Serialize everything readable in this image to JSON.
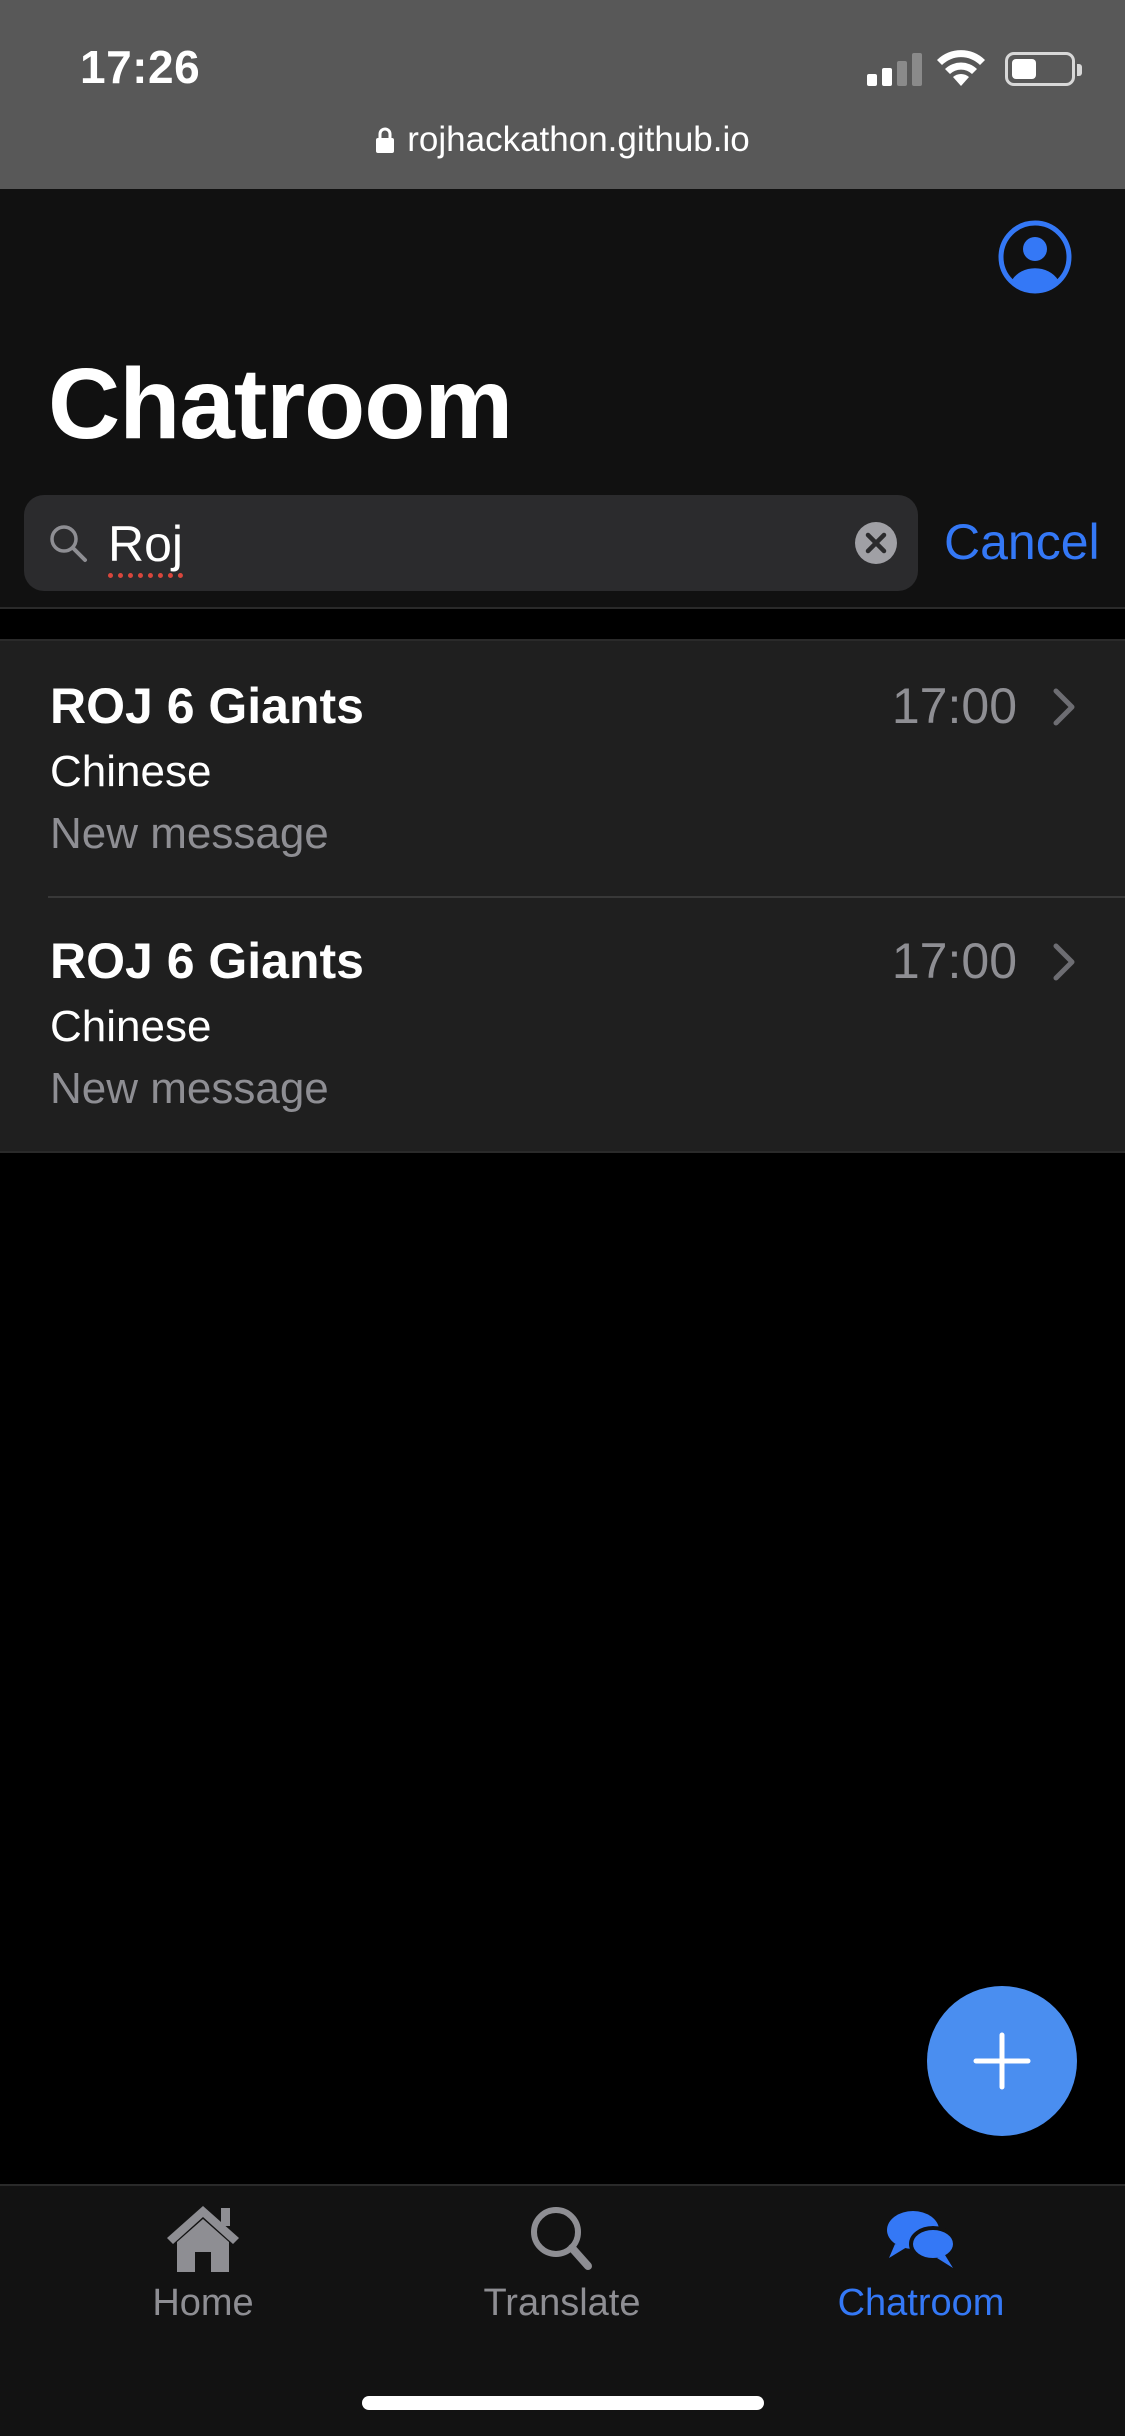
{
  "status_bar": {
    "time": "17:26",
    "url": "rojhackathon.github.io"
  },
  "header": {
    "title": "Chatroom",
    "profile_icon": "user-circle-icon"
  },
  "search": {
    "value": "Roj",
    "cancel_label": "Cancel"
  },
  "chats": [
    {
      "name": "ROJ 6 Giants",
      "language": "Chinese",
      "last_message": "New message",
      "time": "17:00"
    },
    {
      "name": "ROJ 6 Giants",
      "language": "Chinese",
      "last_message": "New message",
      "time": "17:00"
    }
  ],
  "fab": {
    "icon": "plus-icon"
  },
  "tab_bar": {
    "items": [
      {
        "label": "Home",
        "icon": "home-icon",
        "active": false
      },
      {
        "label": "Translate",
        "icon": "search-icon",
        "active": false
      },
      {
        "label": "Chatroom",
        "icon": "chat-bubbles-icon",
        "active": true
      }
    ]
  },
  "colors": {
    "accent": "#3478f6",
    "fab": "#4a8ef0",
    "background": "#000000",
    "list_bg": "#1f1f1f",
    "secondary_text": "#8e8e93"
  }
}
